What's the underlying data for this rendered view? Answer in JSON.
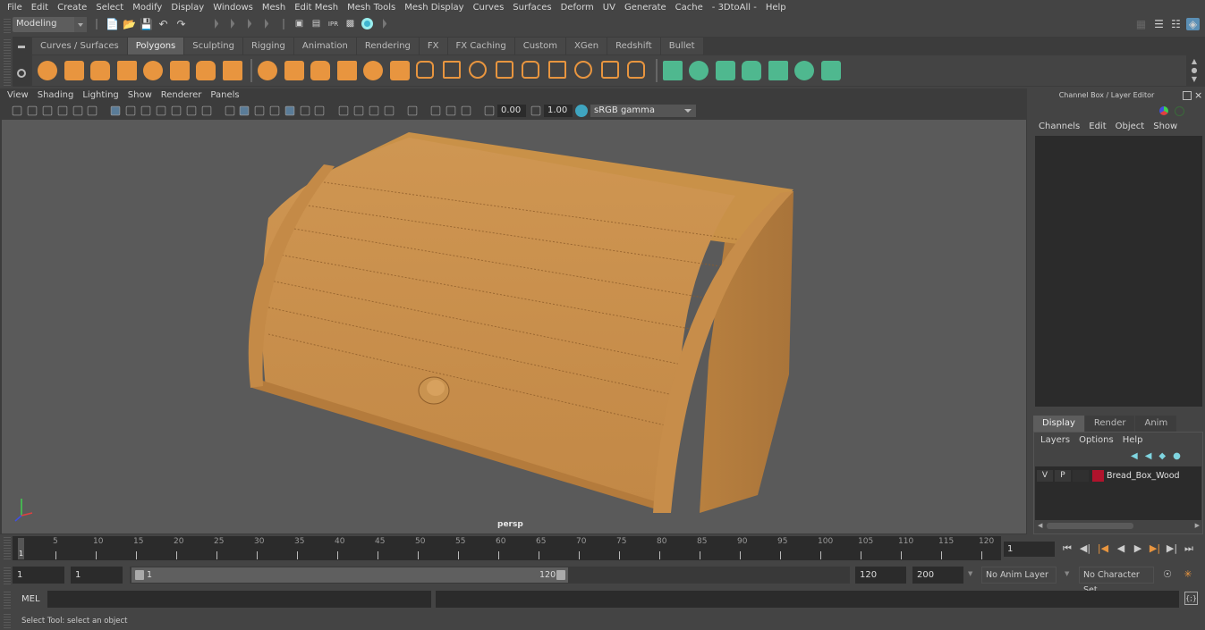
{
  "menubar": {
    "items": [
      "File",
      "Edit",
      "Create",
      "Select",
      "Modify",
      "Display",
      "Windows",
      "Mesh",
      "Edit Mesh",
      "Mesh Tools",
      "Mesh Display",
      "Curves",
      "Surfaces",
      "Deform",
      "UV",
      "Generate",
      "Cache",
      "- 3DtoAll -",
      "Help"
    ]
  },
  "statusline": {
    "mode": "Modeling",
    "icons": [
      "new-scene-icon",
      "open-scene-icon",
      "save-scene-icon",
      "undo-icon",
      "redo-icon",
      "render-view-icon",
      "render-current-frame-icon",
      "ipr-render-icon",
      "render-settings-icon",
      "hypershade-icon"
    ]
  },
  "shelf": {
    "tabs": [
      "Curves / Surfaces",
      "Polygons",
      "Sculpting",
      "Rigging",
      "Animation",
      "Rendering",
      "FX",
      "FX Caching",
      "Custom",
      "XGen",
      "Redshift",
      "Bullet"
    ],
    "active_tab": "Polygons",
    "icons": [
      {
        "name": "poly-sphere-icon",
        "color": "#e8953f"
      },
      {
        "name": "poly-cube-icon",
        "color": "#e8953f"
      },
      {
        "name": "poly-cylinder-icon",
        "color": "#e8953f"
      },
      {
        "name": "poly-cone-icon",
        "color": "#e8953f"
      },
      {
        "name": "poly-plane-icon",
        "color": "#e8953f"
      },
      {
        "name": "poly-torus-icon",
        "color": "#e8953f"
      },
      {
        "name": "poly-pyramid-icon",
        "color": "#e8953f"
      },
      {
        "name": "poly-pipe-icon",
        "color": "#e8953f"
      },
      {
        "name": "combine-icon",
        "color": "#e8953f"
      },
      {
        "name": "separate-icon",
        "color": "#e8953f"
      },
      {
        "name": "mirror-icon",
        "color": "#e8953f"
      },
      {
        "name": "smooth-icon",
        "color": "#e8953f"
      },
      {
        "name": "reduce-icon",
        "color": "#e8953f"
      },
      {
        "name": "smooth-proxy-icon",
        "color": "#e8953f"
      },
      {
        "name": "multi-cut-icon",
        "color": "#e8953f"
      },
      {
        "name": "extrude-icon",
        "color": "#e8953f"
      },
      {
        "name": "bridge-icon",
        "color": "#e8953f"
      },
      {
        "name": "bevel-icon",
        "color": "#e8953f"
      },
      {
        "name": "insert-edge-loop-icon",
        "color": "#e8953f"
      },
      {
        "name": "offset-edge-loop-icon",
        "color": "#e8953f"
      },
      {
        "name": "append-polygon-icon",
        "color": "#e8953f"
      },
      {
        "name": "merge-icon",
        "color": "#e8953f"
      },
      {
        "name": "fill-hole-icon",
        "color": "#e8953f"
      },
      {
        "name": "planar-uv-icon",
        "color": "#4fb88f"
      },
      {
        "name": "cylindrical-uv-icon",
        "color": "#4fb88f"
      },
      {
        "name": "spherical-uv-icon",
        "color": "#4fb88f"
      },
      {
        "name": "automatic-uv-icon",
        "color": "#4fb88f"
      },
      {
        "name": "unfold-uv-icon",
        "color": "#4fb88f"
      },
      {
        "name": "uv-editor-icon",
        "color": "#4fb88f"
      },
      {
        "name": "cut-sew-uv-icon",
        "color": "#4fb88f"
      }
    ]
  },
  "viewport": {
    "menu": [
      "View",
      "Shading",
      "Lighting",
      "Show",
      "Renderer",
      "Panels"
    ],
    "exposure": "0.00",
    "gamma": "1.00",
    "color_space": "sRGB gamma",
    "camera_label": "persp",
    "background_color": "#5a5a5a",
    "model_color": "#c48b4a"
  },
  "channel_box": {
    "title": "Channel Box / Layer Editor",
    "menu": [
      "Channels",
      "Edit",
      "Object",
      "Show"
    ]
  },
  "layer_editor": {
    "tabs": [
      "Display",
      "Render",
      "Anim"
    ],
    "active_tab": "Display",
    "menu": [
      "Layers",
      "Options",
      "Help"
    ],
    "layers": [
      {
        "visible": "V",
        "playback": "P",
        "name": "Bread_Box_Wood",
        "color": "#b0132c"
      }
    ]
  },
  "timeline": {
    "ticks": [
      5,
      10,
      15,
      20,
      25,
      30,
      35,
      40,
      45,
      50,
      55,
      60,
      65,
      70,
      75,
      80,
      85,
      90,
      95,
      100,
      105,
      110,
      115,
      120
    ],
    "start": 1,
    "end": 120,
    "current_frame": "1",
    "current_frame_marker": "1"
  },
  "range": {
    "start_field": "1",
    "playback_start": "1",
    "slider_start_label": "1",
    "slider_end_label": "120",
    "playback_end": "120",
    "anim_end": "200",
    "anim_layer": "No Anim Layer",
    "character_set": "No Character Set"
  },
  "command_line": {
    "label": "MEL",
    "input": "",
    "output": ""
  },
  "help_line": {
    "text": "Select Tool: select an object"
  }
}
